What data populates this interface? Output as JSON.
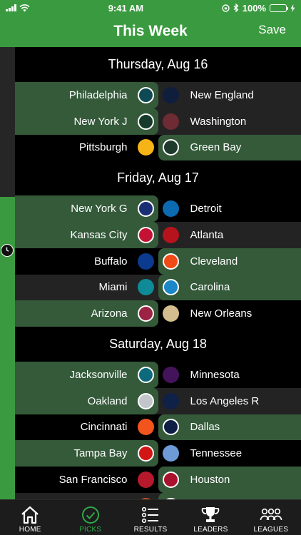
{
  "status_bar": {
    "time": "9:41 AM",
    "battery": "100%"
  },
  "nav": {
    "title": "This Week",
    "save_label": "Save"
  },
  "days": [
    {
      "label": "Thursday, Aug 16",
      "games": [
        {
          "away": "Philadelphia",
          "away_color": "#0d4a53",
          "home": "New England",
          "home_color": "#0f1e3d",
          "pick": "away",
          "alt": true
        },
        {
          "away": "New York J",
          "away_color": "#163a29",
          "home": "Washington",
          "home_color": "#6e2b33",
          "pick": "away",
          "alt": true
        },
        {
          "away": "Pittsburgh",
          "away_color": "#f6b416",
          "home": "Green Bay",
          "home_color": "#1d3a2c",
          "pick": "home",
          "alt": false
        }
      ]
    },
    {
      "label": "Friday, Aug 17",
      "games": [
        {
          "away": "New York G",
          "away_color": "#1a2f73",
          "home": "Detroit",
          "home_color": "#0b6ab0",
          "pick": "away",
          "alt": false
        },
        {
          "away": "Kansas City",
          "away_color": "#c41235",
          "home": "Atlanta",
          "home_color": "#b5141d",
          "pick": "away",
          "alt": true
        },
        {
          "away": "Buffalo",
          "away_color": "#0b3a8f",
          "home": "Cleveland",
          "home_color": "#f04a16",
          "pick": "home",
          "alt": false
        },
        {
          "away": "Miami",
          "away_color": "#0e8b97",
          "home": "Carolina",
          "home_color": "#1b87c9",
          "pick": "home",
          "alt": true
        },
        {
          "away": "Arizona",
          "away_color": "#9c2343",
          "home": "New Orleans",
          "home_color": "#d4bd8e",
          "pick": "away",
          "alt": false
        }
      ]
    },
    {
      "label": "Saturday, Aug 18",
      "games": [
        {
          "away": "Jacksonville",
          "away_color": "#0d6a7d",
          "home": "Minnesota",
          "home_color": "#44145a",
          "pick": "away",
          "alt": false
        },
        {
          "away": "Oakland",
          "away_color": "#c2c6cb",
          "home": "Los Angeles R",
          "home_color": "#0f2147",
          "pick": "away",
          "alt": true
        },
        {
          "away": "Cincinnati",
          "away_color": "#f2541d",
          "home": "Dallas",
          "home_color": "#0d1f44",
          "pick": "home",
          "alt": false
        },
        {
          "away": "Tampa Bay",
          "away_color": "#d21515",
          "home": "Tennessee",
          "home_color": "#6e9bd8",
          "pick": "away",
          "alt": false
        },
        {
          "away": "San Francisco",
          "away_color": "#b5192b",
          "home": "Houston",
          "home_color": "#a8122c",
          "pick": "home",
          "alt": false
        },
        {
          "away": "",
          "away_color": "#c8501d",
          "home": "",
          "home_color": "#1f6d3d",
          "pick": "home",
          "alt": true
        }
      ]
    }
  ],
  "tabs": [
    {
      "label": "HOME",
      "icon": "home-icon",
      "active": false
    },
    {
      "label": "PICKS",
      "icon": "check-circle-icon",
      "active": true
    },
    {
      "label": "RESULTS",
      "icon": "list-icon",
      "active": false
    },
    {
      "label": "LEADERS",
      "icon": "trophy-icon",
      "active": false
    },
    {
      "label": "LEAGUES",
      "icon": "group-icon",
      "active": false
    }
  ]
}
